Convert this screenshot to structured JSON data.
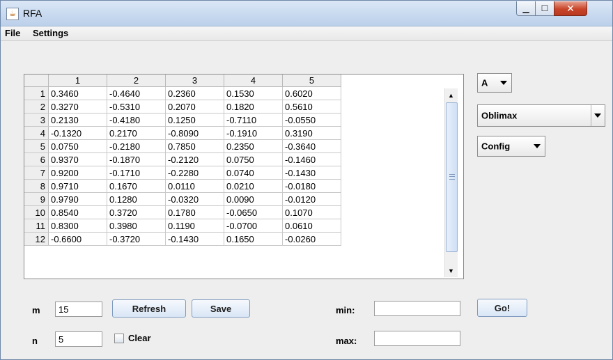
{
  "window": {
    "title": "RFA",
    "app_icon": "java-cup-icon"
  },
  "menu": [
    "File",
    "Settings"
  ],
  "table": {
    "columns": [
      "1",
      "2",
      "3",
      "4",
      "5"
    ],
    "rows": [
      {
        "id": "1",
        "cells": [
          "0.3460",
          "-0.4640",
          "0.2360",
          "0.1530",
          "0.6020"
        ]
      },
      {
        "id": "2",
        "cells": [
          "0.3270",
          "-0.5310",
          "0.2070",
          "0.1820",
          "0.5610"
        ]
      },
      {
        "id": "3",
        "cells": [
          "0.2130",
          "-0.4180",
          "0.1250",
          "-0.7110",
          "-0.0550"
        ]
      },
      {
        "id": "4",
        "cells": [
          "-0.1320",
          "0.2170",
          "-0.8090",
          "-0.1910",
          "0.3190"
        ]
      },
      {
        "id": "5",
        "cells": [
          "0.0750",
          "-0.2180",
          "0.7850",
          "0.2350",
          "-0.3640"
        ]
      },
      {
        "id": "6",
        "cells": [
          "0.9370",
          "-0.1870",
          "-0.2120",
          "0.0750",
          "-0.1460"
        ]
      },
      {
        "id": "7",
        "cells": [
          "0.9200",
          "-0.1710",
          "-0.2280",
          "0.0740",
          "-0.1430"
        ]
      },
      {
        "id": "8",
        "cells": [
          "0.9710",
          "0.1670",
          "0.0110",
          "0.0210",
          "-0.0180"
        ]
      },
      {
        "id": "9",
        "cells": [
          "0.9790",
          "0.1280",
          "-0.0320",
          "0.0090",
          "-0.0120"
        ]
      },
      {
        "id": "10",
        "cells": [
          "0.8540",
          "0.3720",
          "0.1780",
          "-0.0650",
          "0.1070"
        ]
      },
      {
        "id": "11",
        "cells": [
          "0.8300",
          "0.3980",
          "0.1190",
          "-0.0700",
          "0.0610"
        ]
      },
      {
        "id": "12",
        "cells": [
          "-0.6600",
          "-0.3720",
          "-0.1430",
          "0.1650",
          "-0.0260"
        ]
      }
    ]
  },
  "controls": {
    "a_select": "A",
    "method_select": "Oblimax",
    "config_select": "Config",
    "m_label": "m",
    "m_value": "15",
    "n_label": "n",
    "n_value": "5",
    "refresh_label": "Refresh",
    "save_label": "Save",
    "clear_label": "Clear",
    "min_label": "min:",
    "min_value": "",
    "max_label": "max:",
    "max_value": "",
    "go_label": "Go!"
  },
  "colors": {
    "titlebar": "#c7d9ef",
    "close_button": "#c9452a",
    "button": "#d9e6f6",
    "scroll_thumb": "#cfdff4"
  }
}
